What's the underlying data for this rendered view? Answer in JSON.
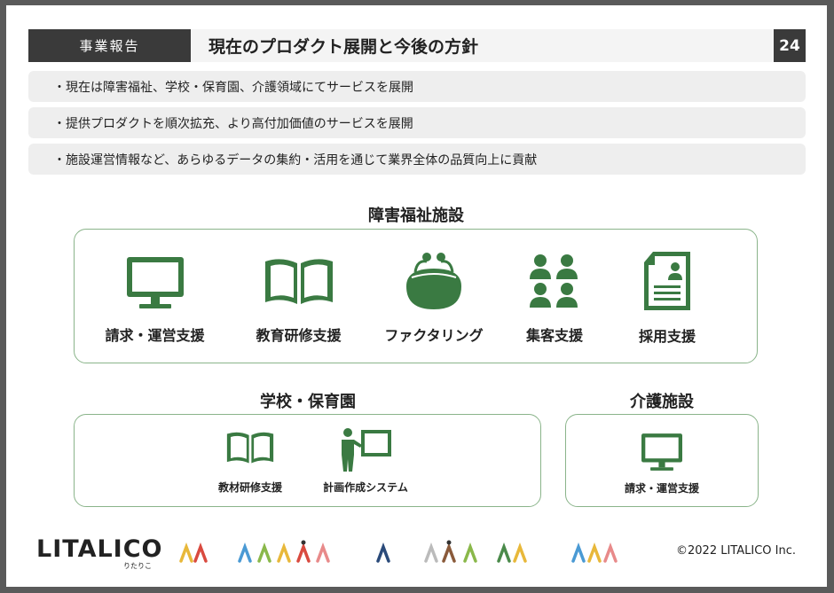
{
  "header": {
    "category": "事業報告",
    "title": "現在のプロダクト展開と今後の方針",
    "page_number": "24"
  },
  "bullets": [
    "・現在は障害福祉、学校・保育園、介護領域にてサービスを展開",
    "・提供プロダクトを順次拡充、より高付加価値のサービスを展開",
    "・施設運営情報など、あらゆるデータの集約・活用を通じて業界全体の品質向上に貢献"
  ],
  "sections": {
    "disability": {
      "title": "障害福祉施設",
      "services": [
        {
          "label": "請求・運営支援",
          "icon": "monitor-icon"
        },
        {
          "label": "教育研修支援",
          "icon": "book-icon"
        },
        {
          "label": "ファクタリング",
          "icon": "coin-purse-icon"
        },
        {
          "label": "集客支援",
          "icon": "group-icon"
        },
        {
          "label": "採用支援",
          "icon": "resume-icon"
        }
      ]
    },
    "school": {
      "title": "学校・保育園",
      "services": [
        {
          "label": "教材研修支援",
          "icon": "book-icon"
        },
        {
          "label": "計画作成システム",
          "icon": "presenter-icon"
        }
      ]
    },
    "care": {
      "title": "介護施設",
      "services": [
        {
          "label": "請求・運営支援",
          "icon": "monitor-icon"
        }
      ]
    }
  },
  "footer": {
    "logo": "LITALICO",
    "logo_sub": "りたりこ",
    "copyright": "©2022 LITALICO Inc."
  },
  "colors": {
    "icon_green": "#3a7a42",
    "panel_border": "#8ab48a",
    "header_dark": "#3a3a3a"
  }
}
